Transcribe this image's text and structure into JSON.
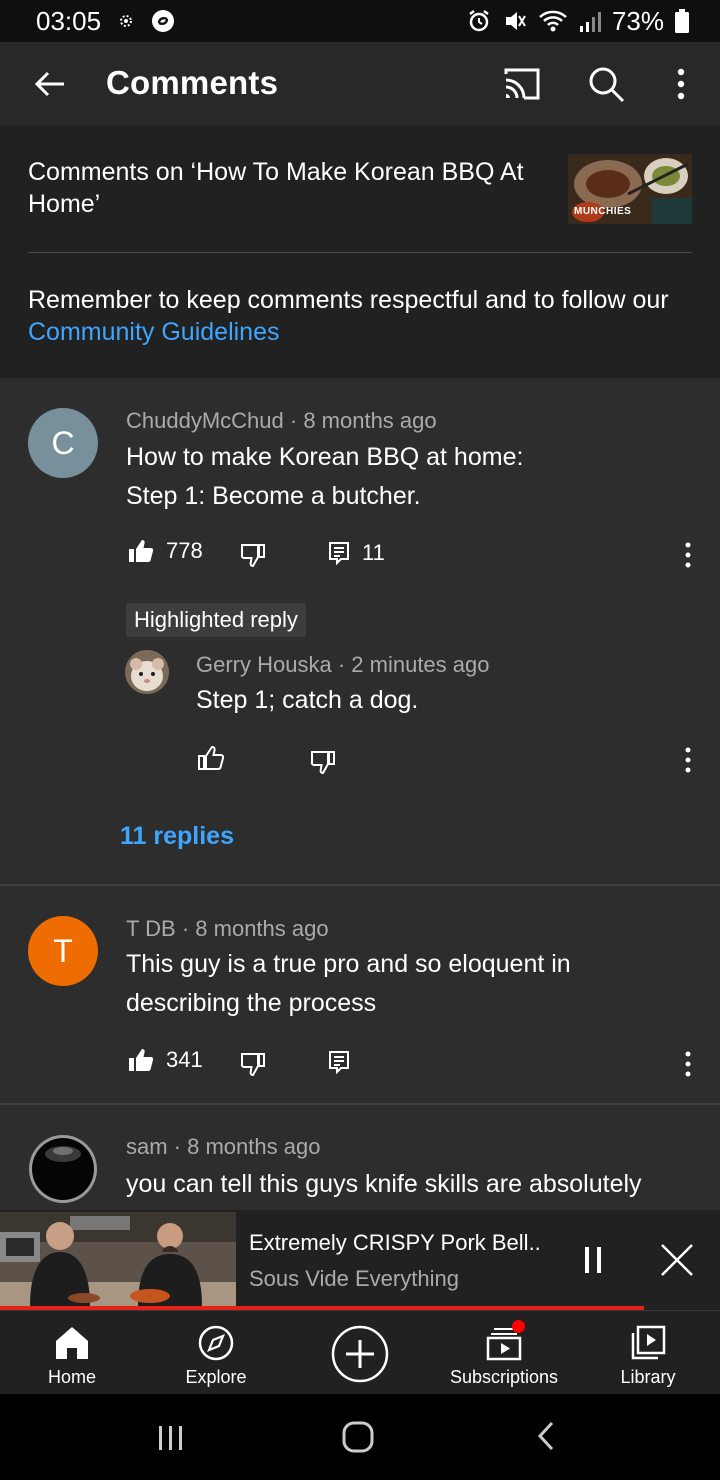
{
  "status_bar": {
    "time": "03:05",
    "battery": "73%"
  },
  "appbar": {
    "title": "Comments"
  },
  "header": {
    "video_title": "Comments on ‘How To Make Korean BBQ At Home’",
    "thumbnail_brand": "MUNCHIES",
    "guidelines_prefix": "Remember to keep comments respectful and to follow our ",
    "guidelines_link": "Community Guidelines"
  },
  "comments": [
    {
      "author": "ChuddyMcChud",
      "time": "8 months ago",
      "avatar_letter": "C",
      "avatar_color": "#78909c",
      "text_line1": "How to make Korean BBQ at home:",
      "text_line2": "Step 1: Become a butcher.",
      "likes": "778",
      "reply_count": "11"
    },
    {
      "author": "T DB",
      "time": "8 months ago",
      "avatar_letter": "T",
      "avatar_color": "#ef6c00",
      "text": "This guy is a true pro and so eloquent in describing the process",
      "likes": "341"
    },
    {
      "author": "sam",
      "time": "8 months ago",
      "text": "you can tell this guys knife skills are absolutely"
    }
  ],
  "highlighted_reply": {
    "badge": "Highlighted reply",
    "author": "Gerry Houska",
    "time": "2 minutes ago",
    "text": "Step 1; catch a dog."
  },
  "replies_link": "11 replies",
  "miniplayer": {
    "title": "Extremely CRISPY Pork Bell..",
    "channel": "Sous Vide Everything",
    "progress": 0.894
  },
  "bottom_nav": {
    "items": [
      {
        "label": "Home",
        "icon": "home-icon"
      },
      {
        "label": "Explore",
        "icon": "explore-icon"
      },
      {
        "label": "",
        "icon": "create-icon"
      },
      {
        "label": "Subscriptions",
        "icon": "subscriptions-icon"
      },
      {
        "label": "Library",
        "icon": "library-icon"
      }
    ]
  },
  "colors": {
    "accent_link": "#3ea6ff",
    "progress": "#e62117",
    "notification_dot": "#ff0000"
  }
}
